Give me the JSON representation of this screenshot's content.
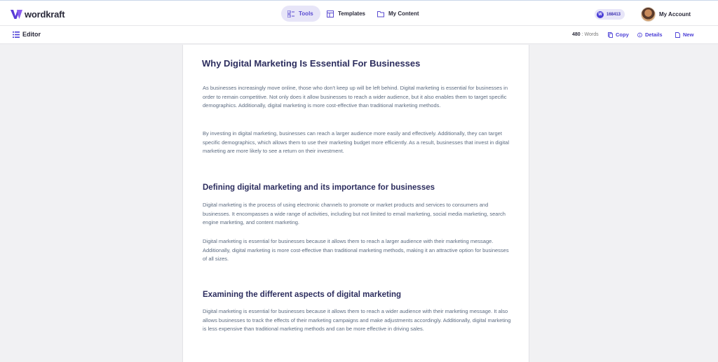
{
  "header": {
    "logo_text": "wordkraft",
    "nav": [
      {
        "label": "Tools",
        "icon": "tools-icon",
        "active": true
      },
      {
        "label": "Templates",
        "icon": "templates-icon"
      },
      {
        "label": "My Content",
        "icon": "folder-icon"
      }
    ],
    "credits": "168413",
    "account_label": "My Account"
  },
  "subbar": {
    "editor_label": "Editor",
    "word_count": "480",
    "words_label": "Words",
    "copy_label": "Copy",
    "details_label": "Details",
    "new_label": "New"
  },
  "document": {
    "title": "Why Digital Marketing Is Essential For Businesses",
    "intro_p1": "As businesses increasingly move online, those who don't keep up will be left behind. Digital marketing is essential for businesses in order to remain competitive. Not only does it allow businesses to reach a wider audience, but it also enables them to target specific demographics. Additionally, digital marketing is more cost-effective than traditional marketing methods.",
    "intro_p2": "By investing in digital marketing, businesses can reach a larger audience more easily and effectively. Additionally, they can target specific demographics, which allows them to use their marketing budget more efficiently. As a result, businesses that invest in digital marketing are more likely to see a return on their investment.",
    "section1_heading": "Defining digital marketing and its importance for businesses",
    "section1_p1": "Digital marketing is the process of using electronic channels to promote or market products and services to consumers and businesses. It encompasses a wide range of activities, including but not limited to email marketing, social media marketing, search engine marketing, and content marketing.",
    "section1_p2": "Digital marketing is essential for businesses because it allows them to reach a larger audience with their marketing message. Additionally, digital marketing is more cost-effective than traditional marketing methods, making it an attractive option for businesses of all sizes.",
    "section2_heading": "Examining the different aspects of digital marketing",
    "section2_p1": "Digital marketing is essential for businesses because it allows them to reach a wider audience with their marketing message. It also allows businesses to track the effects of their marketing campaigns and make adjustments accordingly. Additionally, digital marketing is less expensive than traditional marketing methods and can be more effective in driving sales."
  },
  "colors": {
    "accent": "#4a3dd6",
    "heading": "#2c2d5e",
    "body_text": "#5c6b80",
    "background": "#f1f1f3"
  }
}
